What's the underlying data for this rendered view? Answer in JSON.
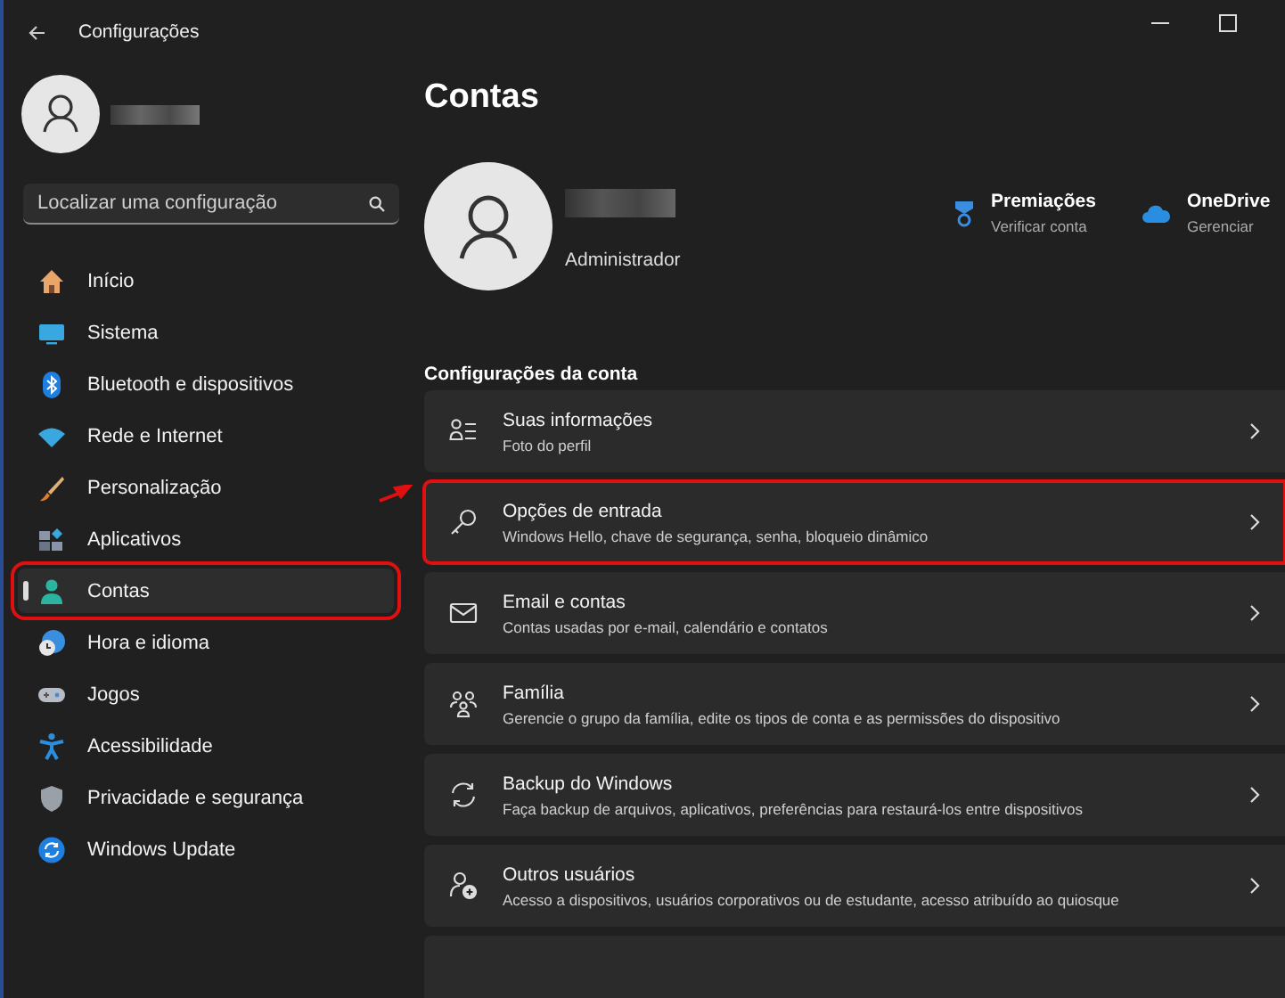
{
  "window": {
    "title": "Configurações"
  },
  "search": {
    "placeholder": "Localizar uma configuração"
  },
  "nav": [
    {
      "label": "Início",
      "kind": "home",
      "selected": false,
      "highlighted": false
    },
    {
      "label": "Sistema",
      "kind": "monitor",
      "selected": false,
      "highlighted": false
    },
    {
      "label": "Bluetooth e dispositivos",
      "kind": "bluetooth",
      "selected": false,
      "highlighted": false
    },
    {
      "label": "Rede e Internet",
      "kind": "wifi",
      "selected": false,
      "highlighted": false
    },
    {
      "label": "Personalização",
      "kind": "brush",
      "selected": false,
      "highlighted": false
    },
    {
      "label": "Aplicativos",
      "kind": "apps",
      "selected": false,
      "highlighted": false
    },
    {
      "label": "Contas",
      "kind": "person",
      "selected": true,
      "highlighted": true
    },
    {
      "label": "Hora e idioma",
      "kind": "clock",
      "selected": false,
      "highlighted": false
    },
    {
      "label": "Jogos",
      "kind": "gamepad",
      "selected": false,
      "highlighted": false
    },
    {
      "label": "Acessibilidade",
      "kind": "access",
      "selected": false,
      "highlighted": false
    },
    {
      "label": "Privacidade e segurança",
      "kind": "shield",
      "selected": false,
      "highlighted": false
    },
    {
      "label": "Windows Update",
      "kind": "update",
      "selected": false,
      "highlighted": false
    }
  ],
  "page": {
    "title": "Contas",
    "role": "Administrador",
    "services": [
      {
        "title": "Premiações",
        "subtitle": "Verificar conta",
        "kind": "medal"
      },
      {
        "title": "OneDrive",
        "subtitle": "Gerenciar",
        "kind": "cloud"
      }
    ],
    "section": "Configurações da conta",
    "cards": [
      {
        "title": "Suas informações",
        "subtitle": "Foto do perfil",
        "kind": "info",
        "highlighted": false
      },
      {
        "title": "Opções de entrada",
        "subtitle": "Windows Hello, chave de segurança, senha, bloqueio dinâmico",
        "kind": "key",
        "highlighted": true
      },
      {
        "title": "Email e contas",
        "subtitle": "Contas usadas por e-mail, calendário e contatos",
        "kind": "mail",
        "highlighted": false
      },
      {
        "title": "Família",
        "subtitle": "Gerencie o grupo da família, edite os tipos de conta e as permissões do dispositivo",
        "kind": "family",
        "highlighted": false
      },
      {
        "title": "Backup do Windows",
        "subtitle": "Faça backup de arquivos, aplicativos, preferências para restaurá-los entre dispositivos",
        "kind": "sync",
        "highlighted": false
      },
      {
        "title": "Outros usuários",
        "subtitle": "Acesso a dispositivos, usuários corporativos ou de estudante, acesso atribuído ao quiosque",
        "kind": "adduser",
        "highlighted": false
      }
    ]
  },
  "annotation_arrow": true
}
